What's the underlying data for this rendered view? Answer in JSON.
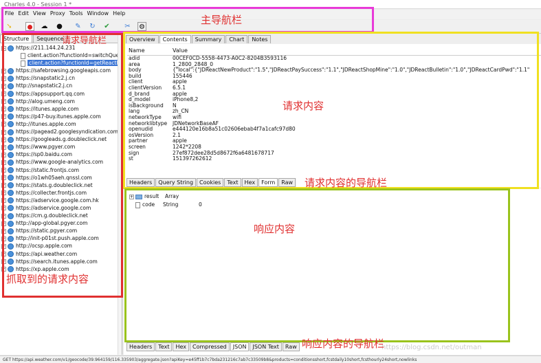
{
  "window": {
    "title": "Charles 4.0 - Session 1 *"
  },
  "menu": [
    "File",
    "Edit",
    "View",
    "Proxy",
    "Tools",
    "Window",
    "Help"
  ],
  "left_tabs": [
    "Structure",
    "Sequence"
  ],
  "tree": {
    "root": "https://211.144.24.231",
    "children": [
      "client.action?functionId=switchQuery",
      "client.action?functionId=getReactFun"
    ],
    "hosts": [
      "https://safebrowsing.googleapis.com",
      "https://snapstatic2.j.cn",
      "http://snapstatic2.j.cn",
      "https://appsupport.qq.com",
      "http://alog.umeng.com",
      "https://itunes.apple.com",
      "https://p47-buy.itunes.apple.com",
      "http://itunes.apple.com",
      "https://pagead2.googlesyndication.com",
      "https://googleads.g.doubleclick.net",
      "https://www.pgyer.com",
      "https://sp0.baidu.com",
      "https://www.google-analytics.com",
      "https://static.frontjs.com",
      "https://o1wh05aeh.qnssl.com",
      "https://stats.g.doubleclick.net",
      "https://collecter.frontjs.com",
      "https://adservice.google.com.hk",
      "https://adservice.google.com",
      "https://cm.g.doubleclick.net",
      "http://app-global.pgyer.com",
      "https://static.pgyer.com",
      "http://init-p01st.push.apple.com",
      "http://ocsp.apple.com",
      "https://api.weather.com",
      "https://search.itunes.apple.com",
      "https://xp.apple.com"
    ]
  },
  "request_tabs": [
    "Overview",
    "Contents",
    "Summary",
    "Chart",
    "Notes"
  ],
  "request_table": {
    "headers": [
      "Name",
      "Value"
    ],
    "rows": [
      [
        "adid",
        "00CEF0CD-5558-4473-A0C2-8204B3593116"
      ],
      [
        "area",
        "1_2800_2848_0"
      ],
      [
        "body",
        "{\"local\":{\"JDReactNewProduct\":\"1.5\",\"JDReactPaySuccess\":\"1.1\",\"JDReactShopMine\":\"1.0\",\"JDReactBulletin\":\"1.0\",\"JDReactCardPwd\":\"1.1\""
      ],
      [
        "build",
        "155446"
      ],
      [
        "client",
        "apple"
      ],
      [
        "clientVersion",
        "6.5.1"
      ],
      [
        "d_brand",
        "apple"
      ],
      [
        "d_model",
        "iPhone8,2"
      ],
      [
        "isBackground",
        "N"
      ],
      [
        "lang",
        "zh_CN"
      ],
      [
        "networkType",
        "wifi"
      ],
      [
        "networklibtype",
        "JDNetworkBaseAF"
      ],
      [
        "openudid",
        "e444120e16b8a51c02606ebab4f7a1cafc97d80"
      ],
      [
        "osVersion",
        "2.1"
      ],
      [
        "partner",
        "apple"
      ],
      [
        "screen",
        "1242*2208"
      ],
      [
        "sign",
        "27ef872dee28d5d8672f6a6481678717"
      ],
      [
        "st",
        "151397262612"
      ]
    ]
  },
  "request_subtabs": [
    "Headers",
    "Query String",
    "Cookies",
    "Text",
    "Hex",
    "Form",
    "Raw"
  ],
  "response_tree": [
    {
      "name": "result",
      "type": "Array",
      "value": ""
    },
    {
      "name": "code",
      "type": "String",
      "value": "0"
    }
  ],
  "response_subtabs": [
    "Headers",
    "Text",
    "Hex",
    "Compressed",
    "JSON",
    "JSON Text",
    "Raw"
  ],
  "status": "GET https://api.weather.com/v1/geocode/39.964159/116.335903/aggregate.json?apiKey=e45ff1b7c7bda231216c7ab7c33509b8&products=conditionsshort,fcstdaily10short,fcsthourly24short,nowlinks",
  "watermark": "https://blog.csdn.net/outman",
  "annotations": {
    "main_nav": "主导航栏",
    "req_nav": "请求导航栏",
    "req_content": "请求内容",
    "req_content_nav": "请求内容的导航栏",
    "resp_content": "响应内容",
    "resp_content_nav": "响应内容的导航栏",
    "captured": "抓取到的请求内容"
  },
  "colors": {
    "main_nav": "#e83ad8",
    "req_nav": "#e03030",
    "req_content": "#f0e020",
    "resp_content": "#9ac31c",
    "label": "#e03030"
  }
}
